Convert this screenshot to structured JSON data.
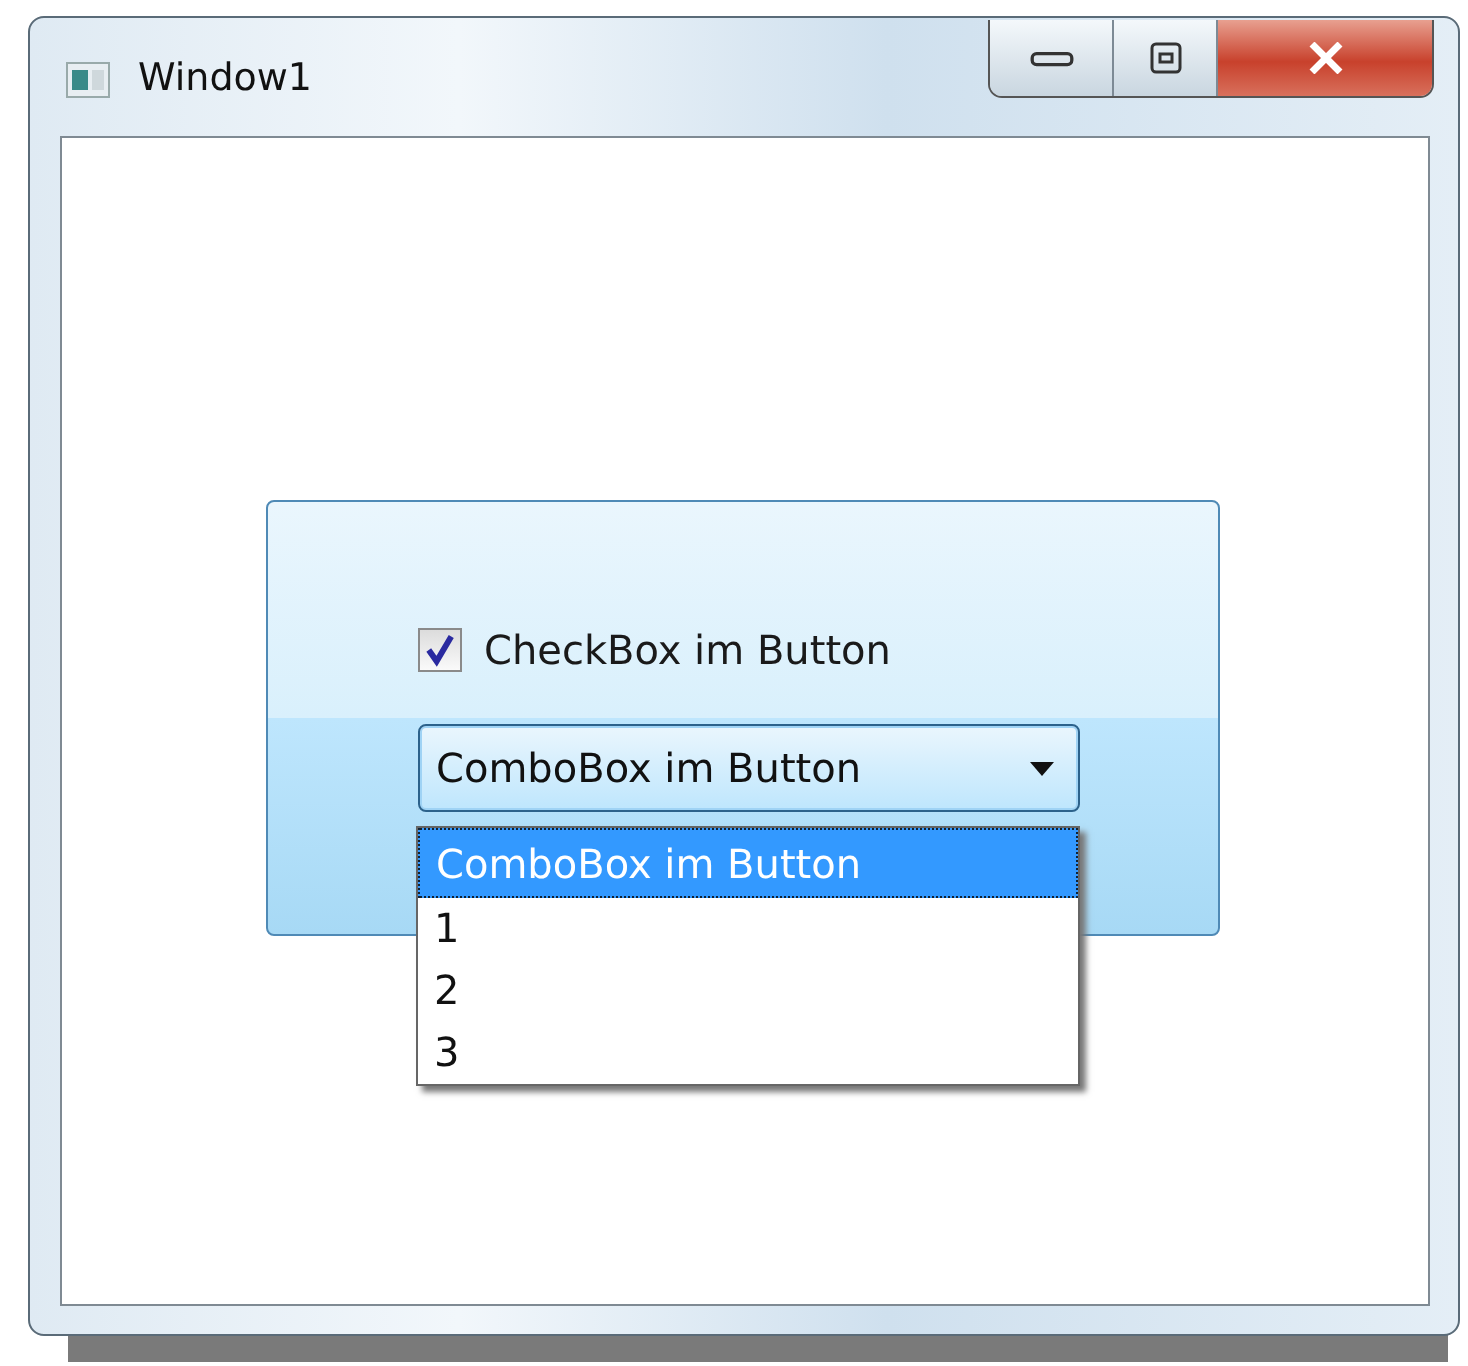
{
  "window": {
    "title": "Window1"
  },
  "button": {
    "checkbox": {
      "label": "CheckBox im Button",
      "checked": true
    },
    "combobox": {
      "value": "ComboBox im Button",
      "expanded": true,
      "options": [
        {
          "label": "ComboBox im Button",
          "selected": true
        },
        {
          "label": "1",
          "selected": false
        },
        {
          "label": "2",
          "selected": false
        },
        {
          "label": "3",
          "selected": false
        }
      ]
    }
  }
}
